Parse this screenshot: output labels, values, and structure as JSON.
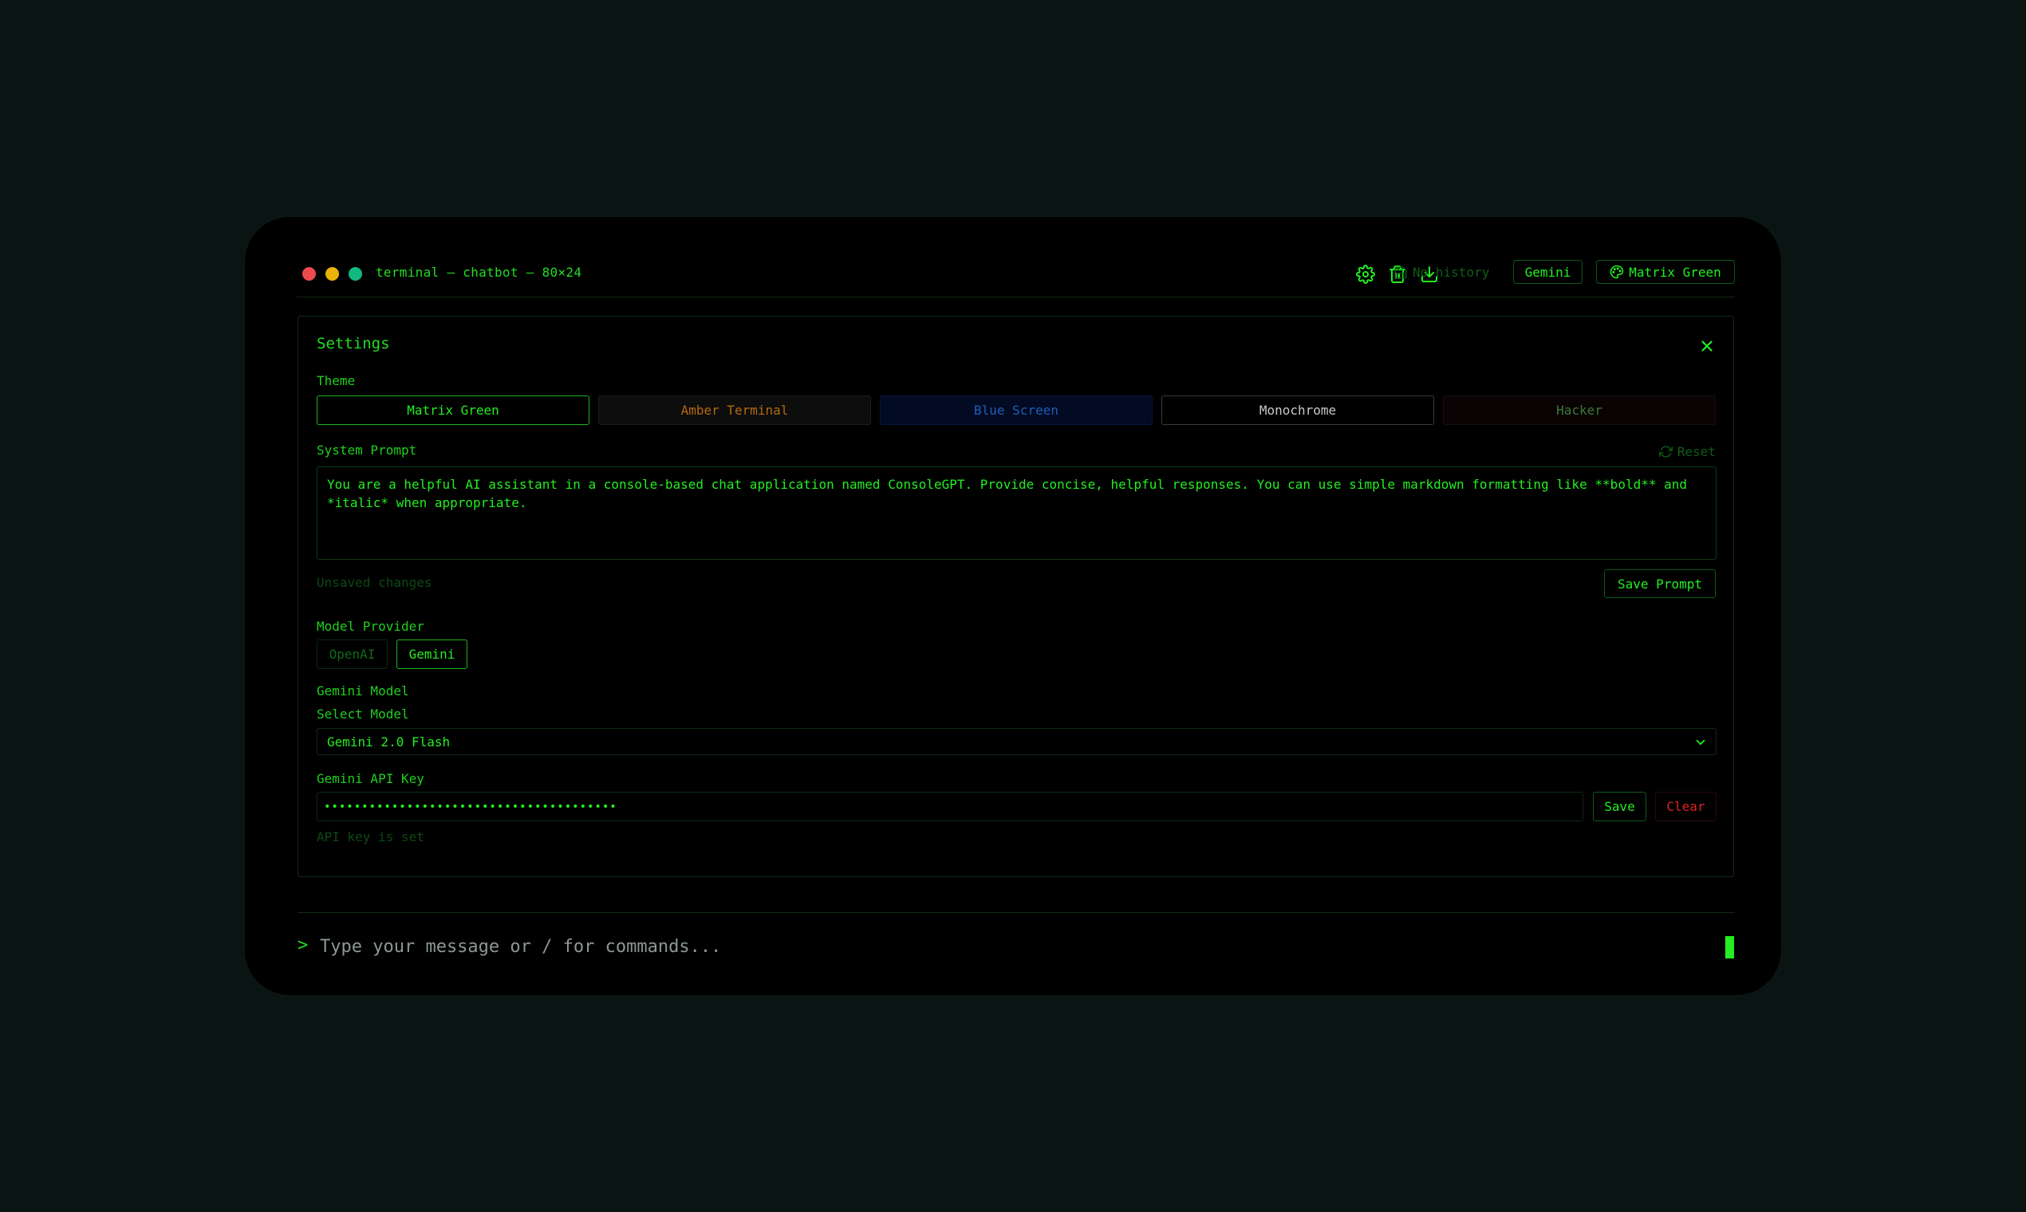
{
  "window": {
    "title": "terminal — chatbot — 80×24"
  },
  "header": {
    "history_label": "No history",
    "provider_chip": "Gemini",
    "theme_chip": "Matrix Green",
    "icons": [
      "settings-icon",
      "trash-icon",
      "download-icon",
      "save-icon",
      "palette-icon"
    ]
  },
  "settings": {
    "title": "Settings",
    "theme_label": "Theme",
    "themes": [
      {
        "label": "Matrix Green",
        "color": "#22ee22",
        "selected": true
      },
      {
        "label": "Amber Terminal",
        "color": "#b56a10"
      },
      {
        "label": "Blue Screen",
        "color": "#1e5fb5"
      },
      {
        "label": "Monochrome",
        "color": "#c8c8c8"
      },
      {
        "label": "Hacker",
        "color": "#3a7a3a"
      }
    ],
    "system_prompt_label": "System Prompt",
    "reset_label": "Reset",
    "system_prompt_value": "You are a helpful AI assistant in a console-based chat application named ConsoleGPT. Provide concise, helpful responses. You can use simple markdown formatting like **bold** and *italic* when appropriate.",
    "unsaved_label": "Unsaved changes",
    "save_prompt_label": "Save Prompt",
    "model_provider_label": "Model Provider",
    "providers": {
      "openai": "OpenAI",
      "gemini": "Gemini"
    },
    "gemini_model_label": "Gemini Model",
    "select_model_label": "Select Model",
    "selected_model": "Gemini 2.0 Flash",
    "api_key_label": "Gemini API Key",
    "api_key_masked": "•••••••••••••••••••••••••••••••••••••••",
    "save_label": "Save",
    "clear_label": "Clear",
    "api_key_status": "API key is set"
  },
  "input": {
    "caret": ">",
    "placeholder": "Type your message or / for commands..."
  },
  "colors": {
    "accent": "#22ee22",
    "background": "#000000",
    "page": "#0a1513",
    "danger": "#e02222"
  }
}
